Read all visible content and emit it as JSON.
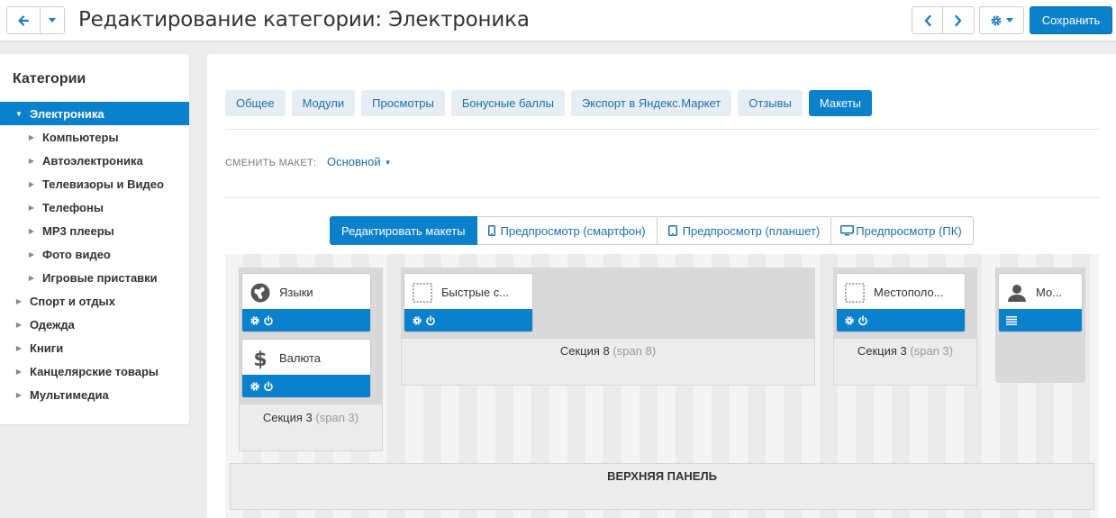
{
  "header": {
    "title": "Редактирование категории: Электроника",
    "save_label": "Сохранить"
  },
  "sidebar": {
    "title": "Категории",
    "items": [
      {
        "label": "Электроника",
        "level": 0,
        "active": true
      },
      {
        "label": "Компьютеры",
        "level": 1
      },
      {
        "label": "Автоэлектроника",
        "level": 1
      },
      {
        "label": "Телевизоры и Видео",
        "level": 1
      },
      {
        "label": "Телефоны",
        "level": 1
      },
      {
        "label": "MP3 плееры",
        "level": 1
      },
      {
        "label": "Фото видео",
        "level": 1
      },
      {
        "label": "Игровые приставки",
        "level": 1
      },
      {
        "label": "Спорт и отдых",
        "level": 0
      },
      {
        "label": "Одежда",
        "level": 0
      },
      {
        "label": "Книги",
        "level": 0
      },
      {
        "label": "Канцелярские товары",
        "level": 0
      },
      {
        "label": "Мультимедиа",
        "level": 0
      }
    ]
  },
  "tabs": [
    {
      "label": "Общее"
    },
    {
      "label": "Модули"
    },
    {
      "label": "Просмотры"
    },
    {
      "label": "Бонусные баллы"
    },
    {
      "label": "Экспорт в Яндекс.Маркет"
    },
    {
      "label": "Отзывы"
    },
    {
      "label": "Макеты",
      "active": true
    }
  ],
  "layout": {
    "label": "СМЕНИТЬ МАКЕТ:",
    "value": "Основной"
  },
  "modes": [
    {
      "label": "Редактировать макеты",
      "active": true
    },
    {
      "label": "Предпросмотр (смартфон)",
      "icon": "smartphone-icon"
    },
    {
      "label": "Предпросмотр (планшет)",
      "icon": "tablet-icon"
    },
    {
      "label": "Предпросмотр (ПК)",
      "icon": "desktop-icon"
    }
  ],
  "sections": [
    {
      "name": "Секция 3",
      "span": "(span 3)"
    },
    {
      "name": "Секция 8",
      "span": "(span 8)"
    },
    {
      "name": "Секция 3",
      "span": "(span 3)"
    }
  ],
  "blocks": [
    {
      "label": "Языки",
      "icon": "globe-icon"
    },
    {
      "label": "Валюта",
      "icon": "dollar-icon"
    },
    {
      "label": "Быстрые с...",
      "icon": "placeholder-icon"
    },
    {
      "label": "Местополо...",
      "icon": "placeholder-icon"
    },
    {
      "label": "Мо...",
      "icon": "user-icon"
    }
  ],
  "top_panel": {
    "label": "ВЕРХНЯЯ ПАНЕЛЬ"
  },
  "colors": {
    "accent": "#0b80cb",
    "tab_bg": "#e6eef4"
  }
}
